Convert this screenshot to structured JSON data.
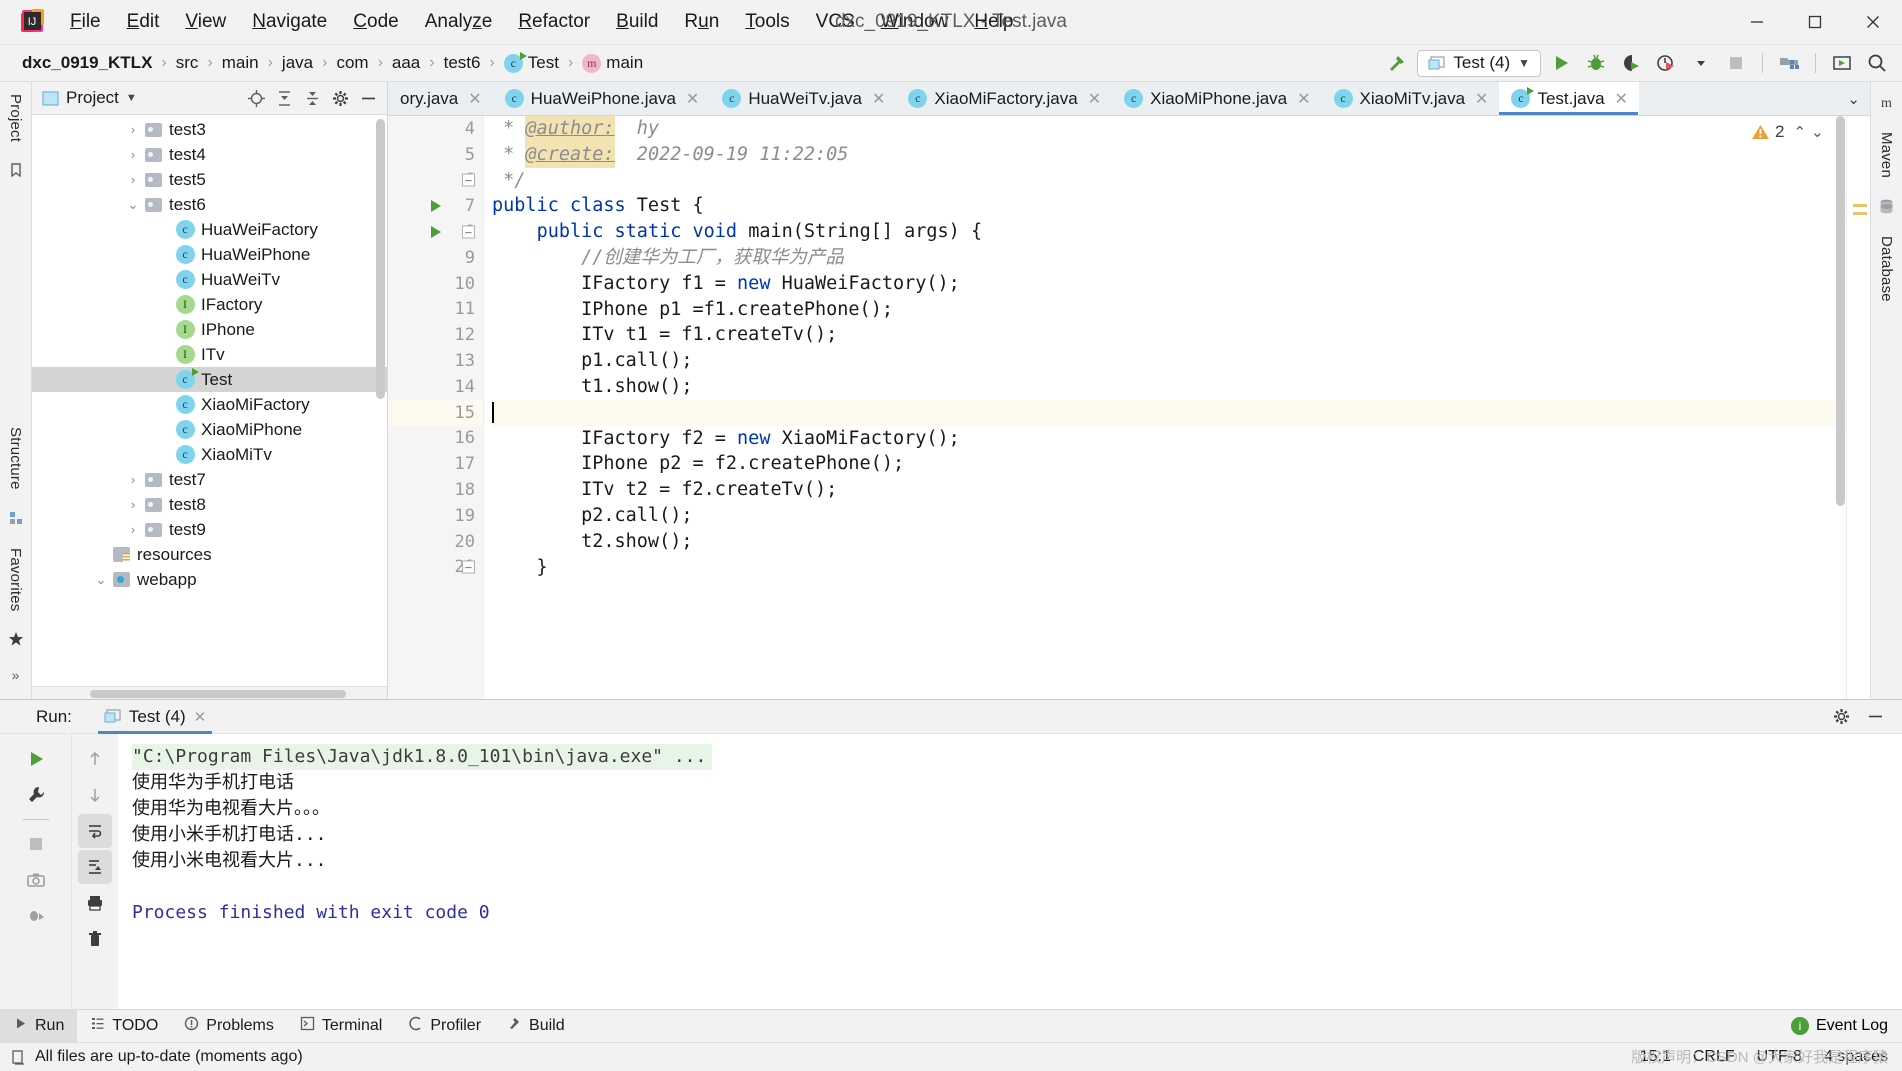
{
  "window": {
    "title": "dxc_0919_KTLX - Test.java",
    "menus": [
      {
        "label": "File",
        "mnemonic": "F"
      },
      {
        "label": "Edit",
        "mnemonic": "E"
      },
      {
        "label": "View",
        "mnemonic": "V"
      },
      {
        "label": "Navigate",
        "mnemonic": "N"
      },
      {
        "label": "Code",
        "mnemonic": "C"
      },
      {
        "label": "Analyze",
        "mnemonic": "z"
      },
      {
        "label": "Refactor",
        "mnemonic": "R"
      },
      {
        "label": "Build",
        "mnemonic": "B"
      },
      {
        "label": "Run",
        "mnemonic": "u"
      },
      {
        "label": "Tools",
        "mnemonic": "T"
      },
      {
        "label": "VCS",
        "mnemonic": ""
      },
      {
        "label": "Window",
        "mnemonic": "W"
      },
      {
        "label": "Help",
        "mnemonic": "H"
      }
    ],
    "controls": {
      "minimize": "─",
      "maximize": "☐",
      "close": "✕"
    }
  },
  "navbar": {
    "breadcrumbs": [
      "dxc_0919_KTLX",
      "src",
      "main",
      "java",
      "com",
      "aaa",
      "test6",
      "Test",
      "main"
    ],
    "separator": "›",
    "run_config": "Test (4)",
    "run_config_caret": "▼",
    "buttons": [
      {
        "name": "build-hammer-icon"
      },
      {
        "name": "run-icon"
      },
      {
        "name": "debug-icon"
      },
      {
        "name": "run-coverage-icon"
      },
      {
        "name": "profiler-icon"
      },
      {
        "name": "profiler-dropdown-icon"
      },
      {
        "name": "stop-icon"
      },
      {
        "name": "project-structure-icon"
      },
      {
        "name": "updates-icon"
      },
      {
        "name": "search-everywhere-icon"
      }
    ]
  },
  "left_rail": {
    "top_label": "Project",
    "bottom_labels": [
      "Structure",
      "Favorites"
    ]
  },
  "right_rail": {
    "labels": [
      "Maven",
      "Database"
    ]
  },
  "project_panel": {
    "title": "Project",
    "title_caret": "▼",
    "actions": [
      "locate-icon",
      "expand-all-icon",
      "collapse-all-icon",
      "settings-gear-icon",
      "hide-icon"
    ],
    "tree": [
      {
        "label": "test3",
        "indent": 2,
        "arrow": "›",
        "icon": "folder",
        "selected": false
      },
      {
        "label": "test4",
        "indent": 2,
        "arrow": "›",
        "icon": "folder",
        "selected": false
      },
      {
        "label": "test5",
        "indent": 2,
        "arrow": "›",
        "icon": "folder",
        "selected": false
      },
      {
        "label": "test6",
        "indent": 2,
        "arrow": "⌄",
        "icon": "folder",
        "selected": false
      },
      {
        "label": "HuaWeiFactory",
        "indent": 3,
        "arrow": "",
        "icon": "class",
        "selected": false
      },
      {
        "label": "HuaWeiPhone",
        "indent": 3,
        "arrow": "",
        "icon": "class",
        "selected": false
      },
      {
        "label": "HuaWeiTv",
        "indent": 3,
        "arrow": "",
        "icon": "class",
        "selected": false
      },
      {
        "label": "IFactory",
        "indent": 3,
        "arrow": "",
        "icon": "interface",
        "selected": false
      },
      {
        "label": "IPhone",
        "indent": 3,
        "arrow": "",
        "icon": "interface",
        "selected": false
      },
      {
        "label": "ITv",
        "indent": 3,
        "arrow": "",
        "icon": "interface",
        "selected": false
      },
      {
        "label": "Test",
        "indent": 3,
        "arrow": "",
        "icon": "class-run",
        "selected": true
      },
      {
        "label": "XiaoMiFactory",
        "indent": 3,
        "arrow": "",
        "icon": "class",
        "selected": false
      },
      {
        "label": "XiaoMiPhone",
        "indent": 3,
        "arrow": "",
        "icon": "class",
        "selected": false
      },
      {
        "label": "XiaoMiTv",
        "indent": 3,
        "arrow": "",
        "icon": "class",
        "selected": false
      },
      {
        "label": "test7",
        "indent": 2,
        "arrow": "›",
        "icon": "folder",
        "selected": false
      },
      {
        "label": "test8",
        "indent": 2,
        "arrow": "›",
        "icon": "folder",
        "selected": false
      },
      {
        "label": "test9",
        "indent": 2,
        "arrow": "›",
        "icon": "folder",
        "selected": false
      },
      {
        "label": "resources",
        "indent": 1,
        "arrow": "",
        "icon": "resources",
        "selected": false
      },
      {
        "label": "webapp",
        "indent": 1,
        "arrow": "⌄",
        "icon": "webapp",
        "selected": false
      }
    ]
  },
  "editor": {
    "tabs": [
      {
        "label": "ory.java",
        "icon": "java-class-icon",
        "active": false,
        "clipped": true
      },
      {
        "label": "HuaWeiPhone.java",
        "icon": "java-class-icon",
        "active": false,
        "clipped": false
      },
      {
        "label": "HuaWeiTv.java",
        "icon": "java-class-icon",
        "active": false,
        "clipped": false
      },
      {
        "label": "XiaoMiFactory.java",
        "icon": "java-class-icon",
        "active": false,
        "clipped": false
      },
      {
        "label": "XiaoMiPhone.java",
        "icon": "java-class-icon",
        "active": false,
        "clipped": false
      },
      {
        "label": "XiaoMiTv.java",
        "icon": "java-class-icon",
        "active": false,
        "clipped": false
      },
      {
        "label": "Test.java",
        "icon": "java-runnable-class-icon",
        "active": true,
        "clipped": false
      }
    ],
    "tab_close": "✕",
    "tabs_more_caret": "⌄",
    "warning_count": "2",
    "inspection_up": "⌃",
    "inspection_down": "⌄",
    "lines": [
      {
        "num": "4",
        "run": false,
        "fold": "",
        "current": false,
        "tokens": [
          {
            "t": " * ",
            "c": "jd"
          },
          {
            "t": "@author:",
            "c": "jdtag"
          },
          {
            "t": "  hy",
            "c": "jd"
          }
        ]
      },
      {
        "num": "5",
        "run": false,
        "fold": "",
        "current": false,
        "tokens": [
          {
            "t": " * ",
            "c": "jd"
          },
          {
            "t": "@create:",
            "c": "jdtag"
          },
          {
            "t": "  2022-09-19 11:22:05",
            "c": "jd"
          }
        ]
      },
      {
        "num": "6",
        "run": false,
        "fold": "minus",
        "current": false,
        "tokens": [
          {
            "t": " */",
            "c": "jd"
          }
        ]
      },
      {
        "num": "7",
        "run": true,
        "fold": "",
        "current": false,
        "tokens": [
          {
            "t": "public class ",
            "c": "k"
          },
          {
            "t": "Test {",
            "c": "pl"
          }
        ]
      },
      {
        "num": "8",
        "run": true,
        "fold": "minus",
        "current": false,
        "tokens": [
          {
            "t": "    ",
            "c": "pl"
          },
          {
            "t": "public static void ",
            "c": "k"
          },
          {
            "t": "main(String[] args) {",
            "c": "pl"
          }
        ]
      },
      {
        "num": "9",
        "run": false,
        "fold": "",
        "current": false,
        "tokens": [
          {
            "t": "        ",
            "c": "pl"
          },
          {
            "t": "//创建华为工厂，获取华为产品",
            "c": "cm"
          }
        ]
      },
      {
        "num": "10",
        "run": false,
        "fold": "",
        "current": false,
        "tokens": [
          {
            "t": "        IFactory f1 = ",
            "c": "pl"
          },
          {
            "t": "new ",
            "c": "k"
          },
          {
            "t": "HuaWeiFactory();",
            "c": "pl"
          }
        ]
      },
      {
        "num": "11",
        "run": false,
        "fold": "",
        "current": false,
        "tokens": [
          {
            "t": "        IPhone p1 =f1.createPhone();",
            "c": "pl"
          }
        ]
      },
      {
        "num": "12",
        "run": false,
        "fold": "",
        "current": false,
        "tokens": [
          {
            "t": "        ITv t1 = f1.createTv();",
            "c": "pl"
          }
        ]
      },
      {
        "num": "13",
        "run": false,
        "fold": "",
        "current": false,
        "tokens": [
          {
            "t": "        p1.call();",
            "c": "pl"
          }
        ]
      },
      {
        "num": "14",
        "run": false,
        "fold": "",
        "current": false,
        "tokens": [
          {
            "t": "        t1.show();",
            "c": "pl"
          }
        ]
      },
      {
        "num": "15",
        "run": false,
        "fold": "",
        "current": true,
        "tokens": [
          {
            "t": "",
            "c": "pl",
            "caret": true
          }
        ]
      },
      {
        "num": "16",
        "run": false,
        "fold": "",
        "current": false,
        "tokens": [
          {
            "t": "        IFactory f2 = ",
            "c": "pl"
          },
          {
            "t": "new ",
            "c": "k"
          },
          {
            "t": "XiaoMiFactory();",
            "c": "pl"
          }
        ]
      },
      {
        "num": "17",
        "run": false,
        "fold": "",
        "current": false,
        "tokens": [
          {
            "t": "        IPhone p2 = f2.createPhone();",
            "c": "pl"
          }
        ]
      },
      {
        "num": "18",
        "run": false,
        "fold": "",
        "current": false,
        "tokens": [
          {
            "t": "        ITv t2 = f2.createTv();",
            "c": "pl"
          }
        ]
      },
      {
        "num": "19",
        "run": false,
        "fold": "",
        "current": false,
        "tokens": [
          {
            "t": "        p2.call();",
            "c": "pl"
          }
        ]
      },
      {
        "num": "20",
        "run": false,
        "fold": "",
        "current": false,
        "tokens": [
          {
            "t": "        t2.show();",
            "c": "pl"
          }
        ]
      },
      {
        "num": "21",
        "run": false,
        "fold": "minus",
        "current": false,
        "tokens": [
          {
            "t": "    }",
            "c": "pl"
          }
        ]
      }
    ]
  },
  "run_window": {
    "label": "Run:",
    "tab": "Test (4)",
    "tab_close": "✕",
    "actions": [
      "settings-gear-icon",
      "hide-icon"
    ],
    "side_buttons": [
      "rerun-icon",
      "wrench-icon",
      "stop-icon",
      "camera-icon",
      "thread-dump-icon"
    ],
    "side_buttons2": [
      "up-arrow-icon",
      "down-arrow-icon",
      "soft-wrap-icon",
      "scroll-to-end-icon",
      "print-icon",
      "trash-icon"
    ],
    "console": [
      {
        "text": "\"C:\\Program Files\\Java\\jdk1.8.0_101\\bin\\java.exe\" ...",
        "style": "cmd"
      },
      {
        "text": "使用华为手机打电话",
        "style": "plain"
      },
      {
        "text": "使用华为电视看大片。。。",
        "style": "plain"
      },
      {
        "text": "使用小米手机打电话...",
        "style": "plain"
      },
      {
        "text": "使用小米电视看大片...",
        "style": "plain"
      },
      {
        "text": "",
        "style": "plain"
      },
      {
        "text": "Process finished with exit code 0",
        "style": "link"
      }
    ]
  },
  "bottom_bar": {
    "items": [
      {
        "label": "Run",
        "icon": "run-icon",
        "active": true
      },
      {
        "label": "TODO",
        "icon": "todo-icon",
        "active": false
      },
      {
        "label": "Problems",
        "icon": "problems-icon",
        "active": false
      },
      {
        "label": "Terminal",
        "icon": "terminal-icon",
        "active": false
      },
      {
        "label": "Profiler",
        "icon": "profiler-icon",
        "active": false
      },
      {
        "label": "Build",
        "icon": "build-icon",
        "active": false
      }
    ],
    "event_log": "Event Log",
    "event_log_badge": "i"
  },
  "status_bar": {
    "message": "All files are up-to-date (moments ago)",
    "caret_position": "15:1",
    "line_separator": "CRLF",
    "encoding": "UTF-8",
    "indent": "4 spaces",
    "watermark": "版权声明：CSDN @大家好我是程序猿"
  },
  "colors": {
    "accent": "#4d87c7",
    "run_green": "#4d9e38",
    "warning_yellow": "#e8a33d",
    "keyword_blue": "#0033b3",
    "console_cmd_bg": "#e7f5e7",
    "selection_gray": "#d4d4d4"
  }
}
